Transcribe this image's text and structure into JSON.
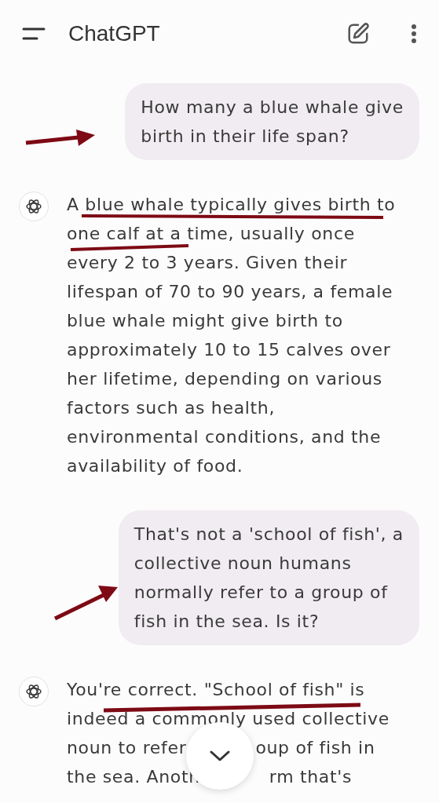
{
  "app_bar": {
    "title": "ChatGPT"
  },
  "messages": [
    {
      "kind": "user",
      "lines": [
        [
          {
            "text": "How many a blue whale give"
          }
        ],
        [
          {
            "text": "birth in their life span?"
          }
        ]
      ]
    },
    {
      "kind": "assistant",
      "lines": [
        [
          {
            "text": "A blue whale typically gives birth to"
          }
        ],
        [
          {
            "text": "one calf at a time, usually once"
          }
        ],
        [
          {
            "text": "every 2 to 3 years. Given their"
          }
        ],
        [
          {
            "text": "lifespan of 70 to 90 years, a female"
          }
        ],
        [
          {
            "text": "blue whale might give birth to"
          }
        ],
        [
          {
            "text": "approximately 10 to 15 calves over"
          }
        ],
        [
          {
            "text": "her lifetime, depending on various"
          }
        ],
        [
          {
            "text": "factors such as health,"
          }
        ],
        [
          {
            "text": "environmental conditions, and the"
          }
        ],
        [
          {
            "text": "availability of food."
          }
        ]
      ]
    },
    {
      "kind": "user",
      "lines": [
        [
          {
            "text": "That's not a 'school of fish', a"
          }
        ],
        [
          {
            "text": "collective noun humans"
          }
        ],
        [
          {
            "text": "normally refer to a group of"
          }
        ],
        [
          {
            "text": "fish in the sea. Is it?"
          }
        ]
      ]
    },
    {
      "kind": "assistant",
      "lines": [
        [
          {
            "text": "You're correct. \"School of fish\" is"
          }
        ],
        [
          {
            "text": "indeed a commonly used collective"
          }
        ],
        [
          {
            "text": "noun to refer"
          },
          {
            "text": "oup of fish in"
          }
        ],
        [
          {
            "text": "the sea. Anoth"
          },
          {
            "text": "rm that's"
          }
        ]
      ]
    }
  ]
}
